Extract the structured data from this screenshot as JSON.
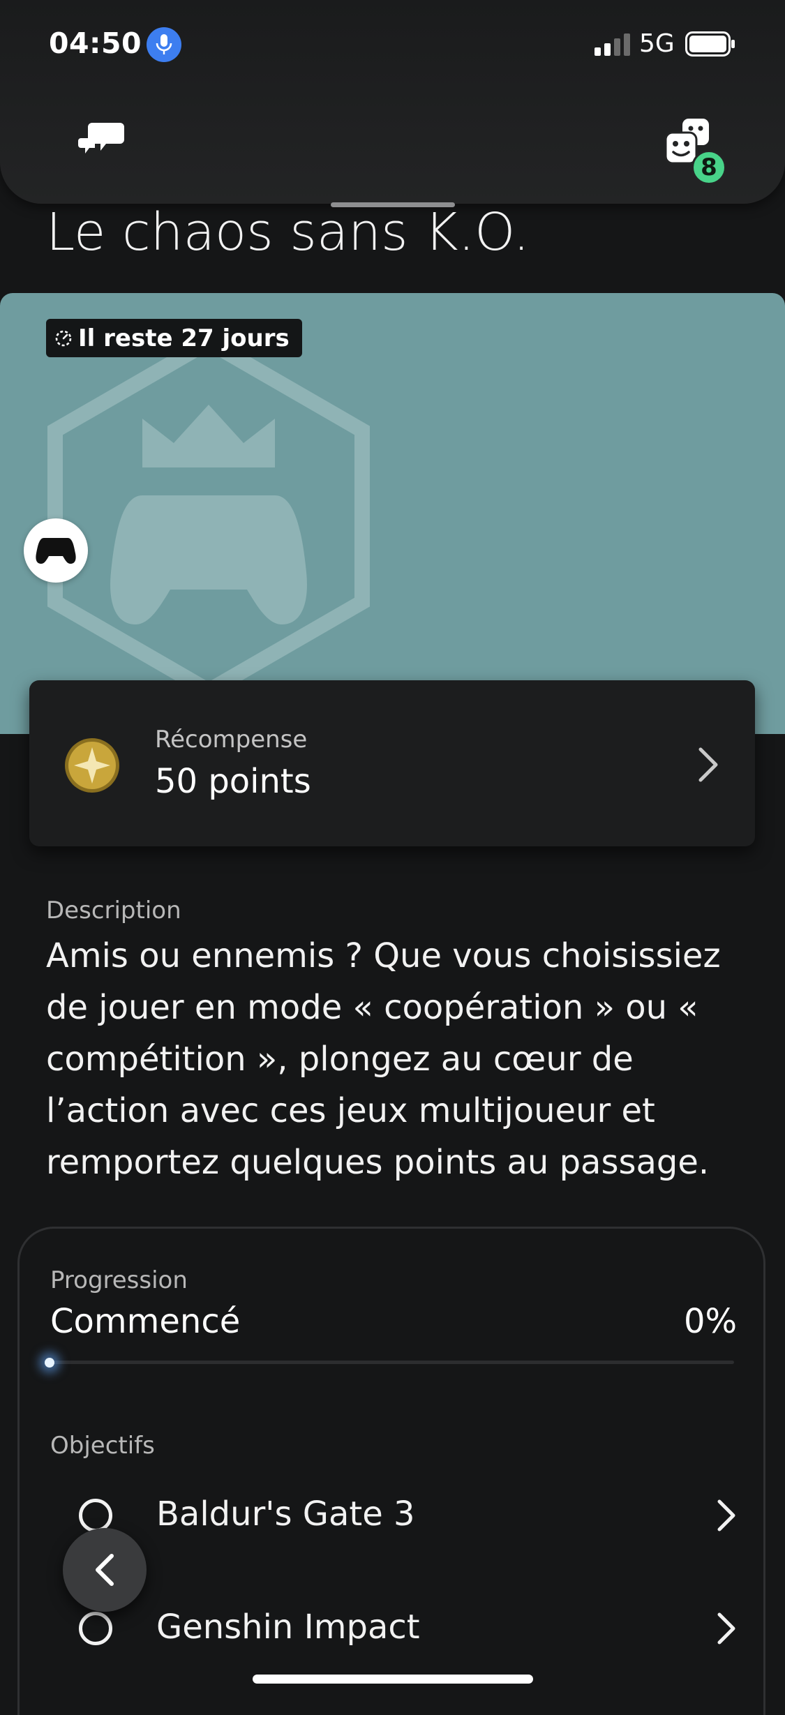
{
  "status_bar": {
    "time": "04:50",
    "network": "5G"
  },
  "header": {
    "friends_badge_count": "8"
  },
  "page": {
    "title": "Le chaos sans K.O."
  },
  "hero": {
    "days_left": "Il reste 27 jours",
    "background_color": "#6f9c9f"
  },
  "reward": {
    "label": "Récompense",
    "value": "50 points"
  },
  "description": {
    "label": "Description",
    "text": "Amis ou ennemis ? Que vous choisissiez de jouer en mode « coopération » ou « compétition », plongez au cœur de l’action avec ces jeux multijoueur et remportez quelques points au passage."
  },
  "progress": {
    "label": "Progression",
    "status": "Commencé",
    "percent": "0%",
    "fraction": 0
  },
  "objectives": {
    "label": "Objectifs",
    "items": [
      {
        "label": "Baldur's Gate 3"
      },
      {
        "label": "Genshin Impact"
      }
    ]
  },
  "colors": {
    "background": "#151617",
    "badge_green": "#48d389",
    "mic_blue": "#3d7ef0",
    "coin_gold": "#c9a63b"
  }
}
